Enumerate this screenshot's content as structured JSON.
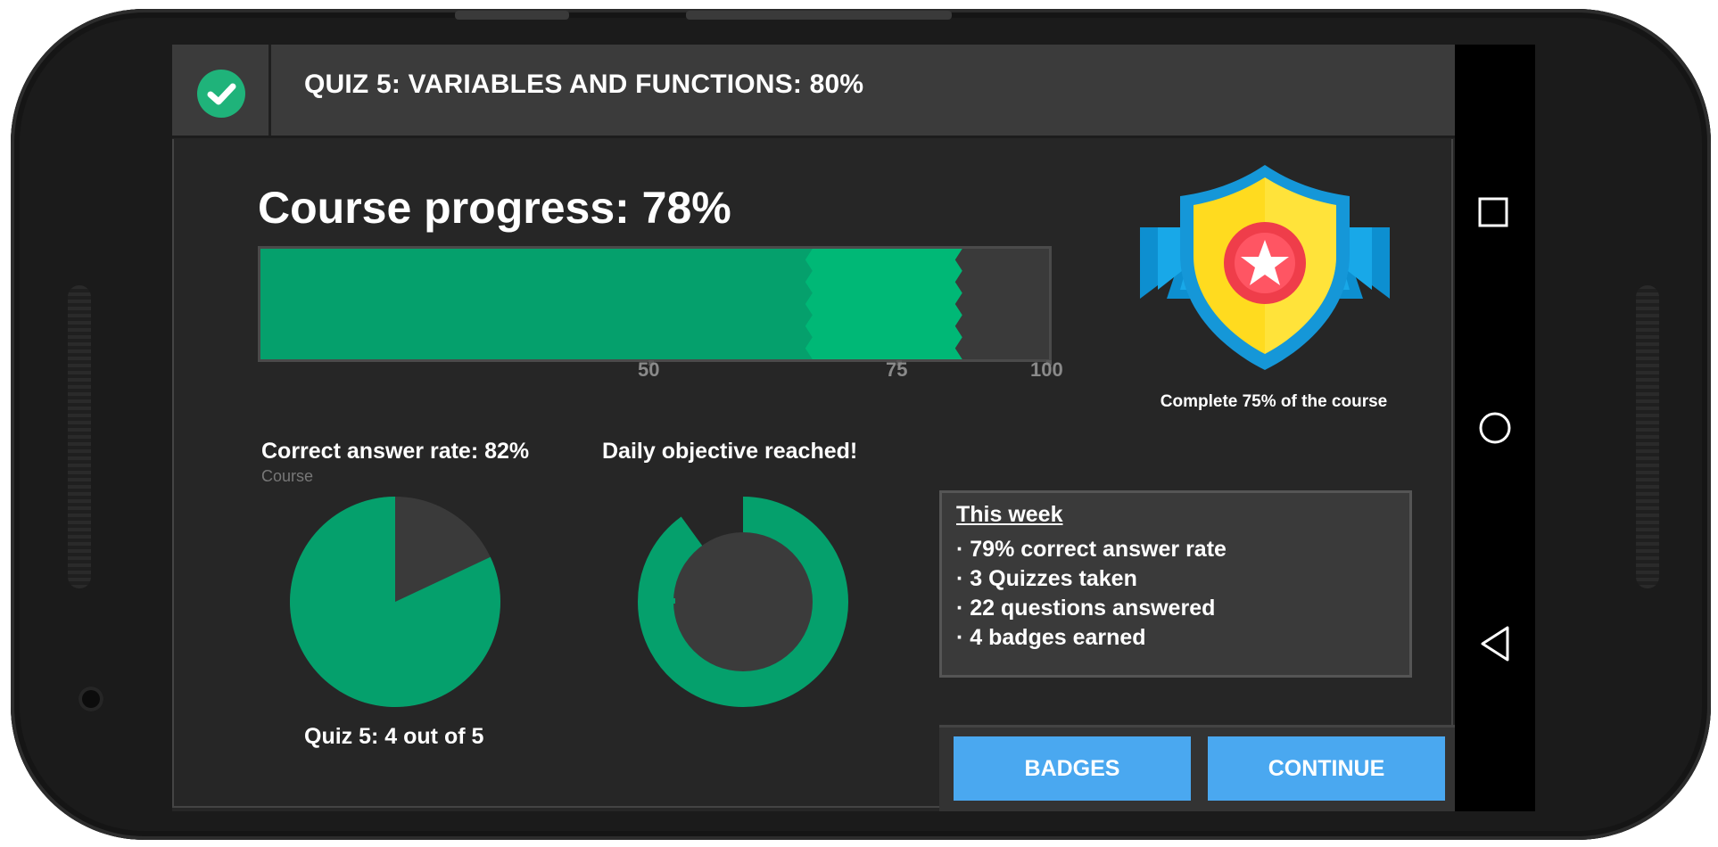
{
  "header": {
    "title": "QUIZ 5: VARIABLES AND FUNCTIONS: 80%"
  },
  "progress": {
    "title": "Course progress: 78%",
    "previous_fraction": 0.7,
    "current_fraction": 0.89,
    "ticks": [
      "50",
      "75",
      "100"
    ]
  },
  "badge": {
    "caption": "Complete 75% of the course"
  },
  "correct_rate": {
    "label": "Correct answer rate: 82%",
    "sub": "Course",
    "value": 0.82,
    "caption": "Quiz 5: 4 out of 5"
  },
  "daily": {
    "label": "Daily objective reached!",
    "value": 0.9
  },
  "week": {
    "title": "This week",
    "items": [
      "· 79% correct answer rate",
      "· 3 Quizzes taken",
      "· 22 questions answered",
      "· 4 badges earned"
    ]
  },
  "buttons": {
    "badges": "BADGES",
    "continue": "CONTINUE"
  },
  "colors": {
    "green_dark": "#05a06c",
    "green_light": "#00b876",
    "blue": "#4aa8f0"
  }
}
